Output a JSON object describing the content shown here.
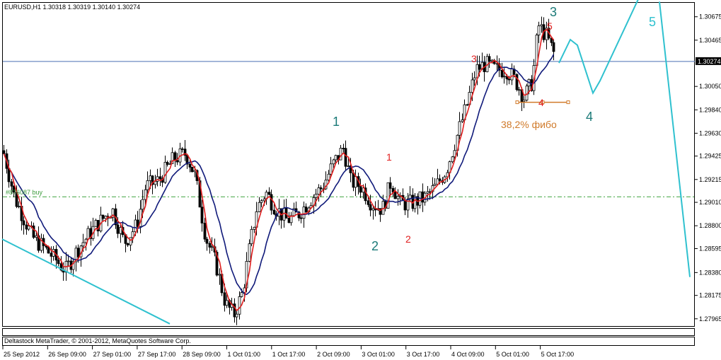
{
  "chart_data": {
    "type": "candlestick",
    "title": "EURUSD,H1  1.30318 1.30319 1.30140 1.30274",
    "current_price": "1.30274",
    "ylim": [
      1.279,
      1.308
    ],
    "y_ticks": [
      "1.30675",
      "1.30465",
      "1.30274",
      "1.30050",
      "1.29840",
      "1.29630",
      "1.29425",
      "1.29215",
      "1.29010",
      "1.28800",
      "1.28595",
      "1.28380",
      "1.28175",
      "1.27965"
    ],
    "x_ticks": [
      "25 Sep 2012",
      "26 Sep 09:00",
      "27 Sep 01:00",
      "27 Sep 17:00",
      "28 Sep 09:00",
      "1 Oct 01:00",
      "1 Oct 17:00",
      "2 Oct 09:00",
      "3 Oct 01:00",
      "3 Oct 17:00",
      "4 Oct 09:00",
      "5 Oct 01:00",
      "5 Oct 17:00"
    ],
    "order_line_label": "#876087 buy",
    "order_line_price": 1.2906,
    "copyright": "Deltastock MetaTrader, © 2001-2012, MetaQuotes Software Corp.",
    "fibo_label": "38,2% фибо",
    "wave_labels_large": [
      "1",
      "2",
      "3",
      "4",
      "5"
    ],
    "wave_labels_small": [
      "1",
      "2",
      "3",
      "4",
      "5"
    ],
    "anchors": [
      {
        "x": 0,
        "p": 1.2958
      },
      {
        "x": 20,
        "p": 1.2905
      },
      {
        "x": 45,
        "p": 1.287
      },
      {
        "x": 70,
        "p": 1.2855
      },
      {
        "x": 92,
        "p": 1.284
      },
      {
        "x": 110,
        "p": 1.286
      },
      {
        "x": 135,
        "p": 1.288
      },
      {
        "x": 158,
        "p": 1.2895
      },
      {
        "x": 175,
        "p": 1.2865
      },
      {
        "x": 192,
        "p": 1.288
      },
      {
        "x": 205,
        "p": 1.2915
      },
      {
        "x": 222,
        "p": 1.292
      },
      {
        "x": 245,
        "p": 1.294
      },
      {
        "x": 262,
        "p": 1.2945
      },
      {
        "x": 275,
        "p": 1.2925
      },
      {
        "x": 290,
        "p": 1.287
      },
      {
        "x": 305,
        "p": 1.2845
      },
      {
        "x": 318,
        "p": 1.281
      },
      {
        "x": 330,
        "p": 1.28
      },
      {
        "x": 342,
        "p": 1.282
      },
      {
        "x": 352,
        "p": 1.286
      },
      {
        "x": 362,
        "p": 1.2895
      },
      {
        "x": 375,
        "p": 1.291
      },
      {
        "x": 390,
        "p": 1.2895
      },
      {
        "x": 405,
        "p": 1.2885
      },
      {
        "x": 420,
        "p": 1.289
      },
      {
        "x": 440,
        "p": 1.2905
      },
      {
        "x": 455,
        "p": 1.2915
      },
      {
        "x": 470,
        "p": 1.2935
      },
      {
        "x": 485,
        "p": 1.295
      },
      {
        "x": 495,
        "p": 1.292
      },
      {
        "x": 510,
        "p": 1.2915
      },
      {
        "x": 525,
        "p": 1.29
      },
      {
        "x": 540,
        "p": 1.2895
      },
      {
        "x": 552,
        "p": 1.292
      },
      {
        "x": 565,
        "p": 1.29
      },
      {
        "x": 580,
        "p": 1.29
      },
      {
        "x": 600,
        "p": 1.2905
      },
      {
        "x": 615,
        "p": 1.2915
      },
      {
        "x": 630,
        "p": 1.293
      },
      {
        "x": 645,
        "p": 1.296
      },
      {
        "x": 660,
        "p": 1.299
      },
      {
        "x": 672,
        "p": 1.302
      },
      {
        "x": 685,
        "p": 1.3025
      },
      {
        "x": 700,
        "p": 1.302
      },
      {
        "x": 715,
        "p": 1.302
      },
      {
        "x": 728,
        "p": 1.301
      },
      {
        "x": 740,
        "p": 1.2995
      },
      {
        "x": 752,
        "p": 1.301
      },
      {
        "x": 760,
        "p": 1.306
      },
      {
        "x": 772,
        "p": 1.305
      },
      {
        "x": 782,
        "p": 1.3035
      }
    ],
    "wave_forecast": [
      {
        "x": 790,
        "p": 1.3026
      },
      {
        "x": 806,
        "p": 1.3047
      },
      {
        "x": 816,
        "p": 1.3042
      },
      {
        "x": 838,
        "p": 1.2999
      },
      {
        "x": 848,
        "p": 1.301
      },
      {
        "x": 910,
        "p": 1.3094
      }
    ],
    "wave_drop": [
      {
        "x": 932,
        "p": 1.3081
      },
      {
        "x": 975,
        "p": 1.2834
      }
    ],
    "trendline": [
      {
        "x": 3,
        "p": 1.2868
      },
      {
        "x": 240,
        "p": 1.2792
      }
    ],
    "fibo_line": [
      {
        "x": 731,
        "p": 1.29908
      },
      {
        "x": 803,
        "p": 1.29908
      }
    ]
  }
}
